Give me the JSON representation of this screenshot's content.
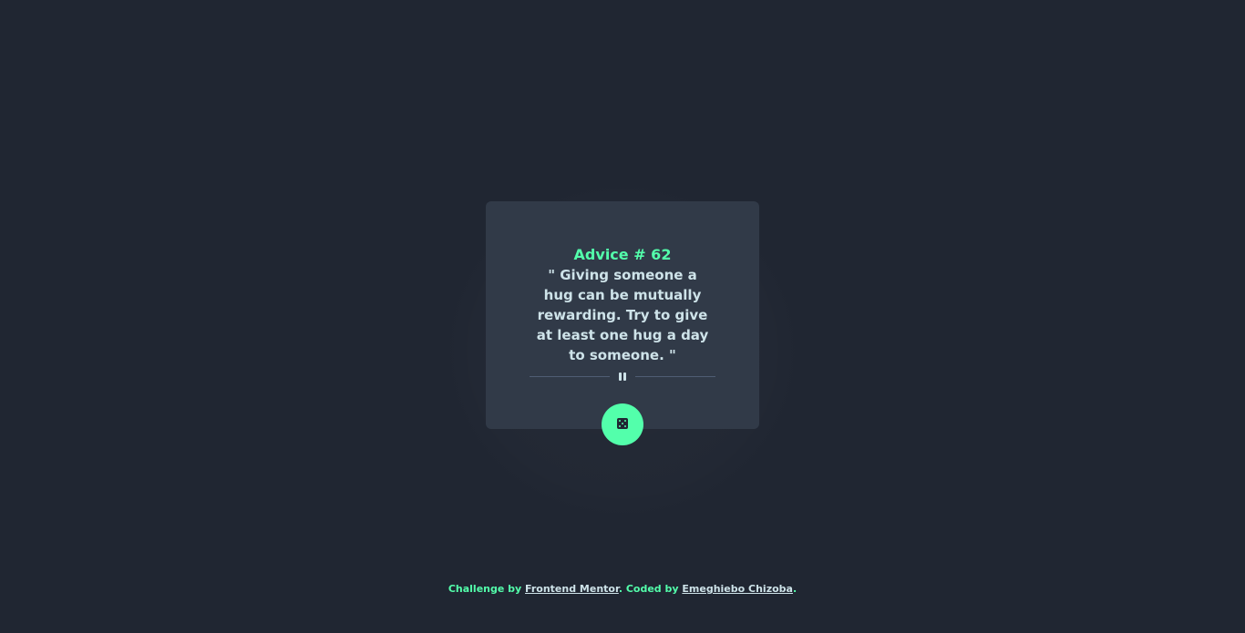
{
  "card": {
    "advice_title": "Advice # 62",
    "advice_text": "\" Giving someone a hug can be mutually rewarding. Try to give at least one hug a day to someone. \""
  },
  "button": {
    "icon": "dice-icon"
  },
  "footer": {
    "challenge_by": "Challenge by ",
    "frontend_mentor": "Frontend Mentor",
    "coded_by": ". Coded by ",
    "author": "Emeghiebo Chizoba",
    "period": "."
  },
  "colors": {
    "background": "#202632",
    "card": "#313a48",
    "accent": "#53ffab",
    "text": "#cee3e9",
    "divider": "#4f5d74"
  }
}
